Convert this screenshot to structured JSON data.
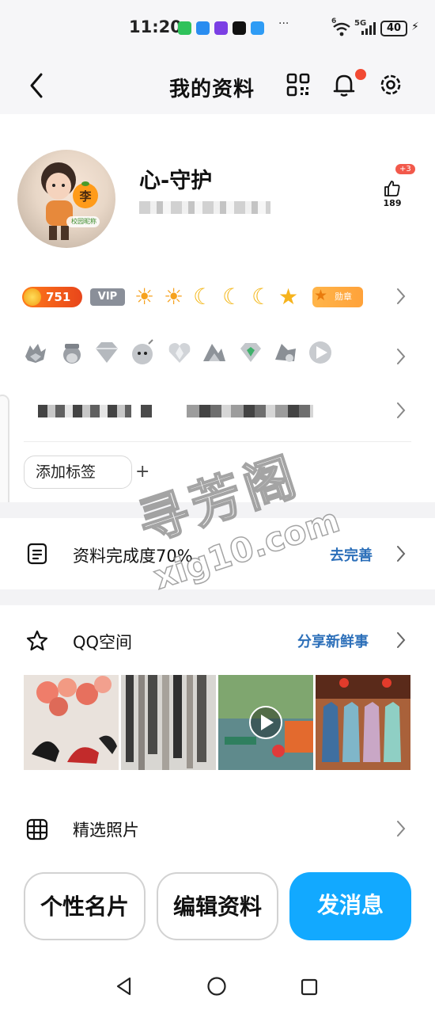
{
  "status_bar": {
    "time": "11:20",
    "more": "···",
    "signal_left": "6",
    "signal_5g": "5G",
    "battery": "40"
  },
  "header": {
    "title": "我的资料",
    "has_notification": true
  },
  "profile": {
    "username": "心-守护",
    "like_badge": "+3",
    "like_count": "189",
    "avatar_char": "李",
    "avatar_tag": "校园昵称"
  },
  "badges": {
    "coins": "751",
    "vip": "VIP",
    "medal_label": "勋章"
  },
  "tags": {
    "add_label": "添加标签",
    "add_icon": "+"
  },
  "completion": {
    "label": "资料完成度70%",
    "action": "去完善"
  },
  "qzone": {
    "label": "QQ空间",
    "action": "分享新鲜事"
  },
  "featured": {
    "label": "精选照片"
  },
  "buttons": {
    "card": "个性名片",
    "edit": "编辑资料",
    "message": "发消息"
  },
  "watermark": {
    "line1": "寻芳阁",
    "line2": "xig10.com"
  },
  "colors": {
    "accent": "#12a9ff",
    "link": "#2c6fb9",
    "coin": "#f0591c",
    "red_dot": "#f24a33"
  }
}
